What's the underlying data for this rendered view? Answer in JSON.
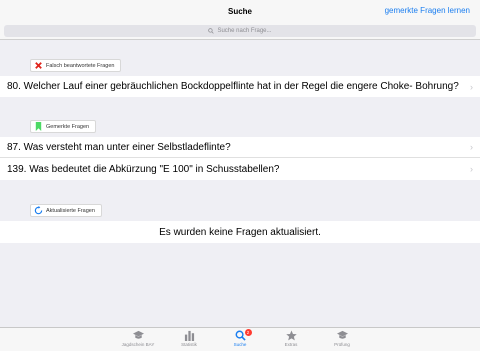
{
  "navbar": {
    "title": "Suche",
    "right_action": "gemerkte Fragen lernen"
  },
  "search": {
    "placeholder": "Suche nach Frage..."
  },
  "sections": {
    "wrong": {
      "label": "Falsch beantwortete Fragen",
      "icon": "red-x-icon",
      "items": [
        "80. Welcher Lauf einer gebräuchlichen Bockdoppelflinte hat in der Regel die engere Choke- Bohrung?"
      ]
    },
    "saved": {
      "label": "Gemerkte Fragen",
      "icon": "bookmark-icon",
      "items": [
        "87. Was versteht man unter einer Selbstladeflinte?",
        "139. Was bedeutet die Abkürzung \"E 100\" in Schusstabellen?"
      ]
    },
    "updated": {
      "label": "Aktualisierte Fragen",
      "icon": "refresh-icon",
      "empty_text": "Es wurden keine Fragen aktualisiert."
    }
  },
  "tabbar": {
    "tabs": [
      {
        "label": "Jagdschein BAY",
        "icon": "mortarboard-icon"
      },
      {
        "label": "Statistik",
        "icon": "bar-chart-icon"
      },
      {
        "label": "Suche",
        "icon": "search-icon",
        "badge": "2",
        "active": true
      },
      {
        "label": "Extras",
        "icon": "star-icon"
      },
      {
        "label": "Prüfung",
        "icon": "mortarboard-icon"
      }
    ]
  },
  "colors": {
    "accent": "#1a7ef0",
    "badge_red": "#ff3b30",
    "bookmark_green": "#4cd964",
    "background": "#efeff4"
  }
}
